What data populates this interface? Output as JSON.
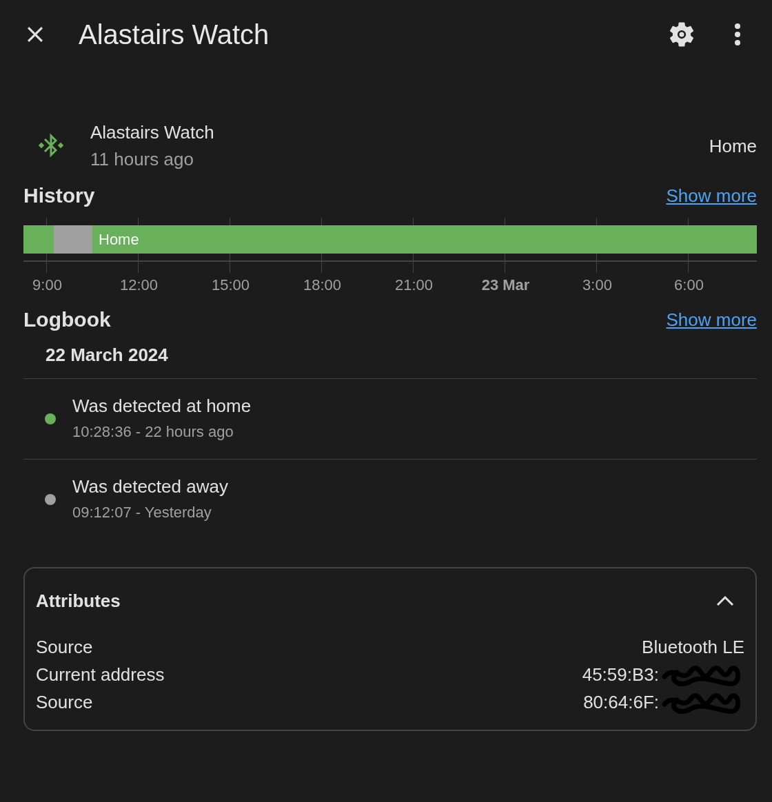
{
  "header": {
    "title": "Alastairs Watch"
  },
  "entity": {
    "name": "Alastairs Watch",
    "last_changed": "11 hours ago",
    "state": "Home"
  },
  "history": {
    "title": "History",
    "link": "Show more",
    "segments": [
      {
        "color": "#69b05a"
      },
      {
        "color": "#a0a0a0"
      },
      {
        "color": "#69b05a",
        "label": "Home"
      }
    ],
    "ticks": [
      {
        "label": "9:00",
        "bold": false
      },
      {
        "label": "12:00",
        "bold": false
      },
      {
        "label": "15:00",
        "bold": false
      },
      {
        "label": "18:00",
        "bold": false
      },
      {
        "label": "21:00",
        "bold": false
      },
      {
        "label": "23 Mar",
        "bold": true
      },
      {
        "label": "3:00",
        "bold": false
      },
      {
        "label": "6:00",
        "bold": false
      }
    ]
  },
  "logbook": {
    "title": "Logbook",
    "link": "Show more",
    "date": "22 March 2024",
    "entries": [
      {
        "message": "Was detected at home",
        "time": "10:28:36 - 22 hours ago",
        "color": "#69b05a"
      },
      {
        "message": "Was detected away",
        "time": "09:12:07 - Yesterday",
        "color": "#a0a0a0"
      }
    ]
  },
  "attributes": {
    "title": "Attributes",
    "expanded": true,
    "rows": [
      {
        "name": "Source",
        "value": "Bluetooth LE",
        "redacted": false
      },
      {
        "name": "Current address",
        "value": "45:59:B3:",
        "redacted": true
      },
      {
        "name": "Source",
        "value": "80:64:6F:",
        "redacted": true
      }
    ]
  }
}
